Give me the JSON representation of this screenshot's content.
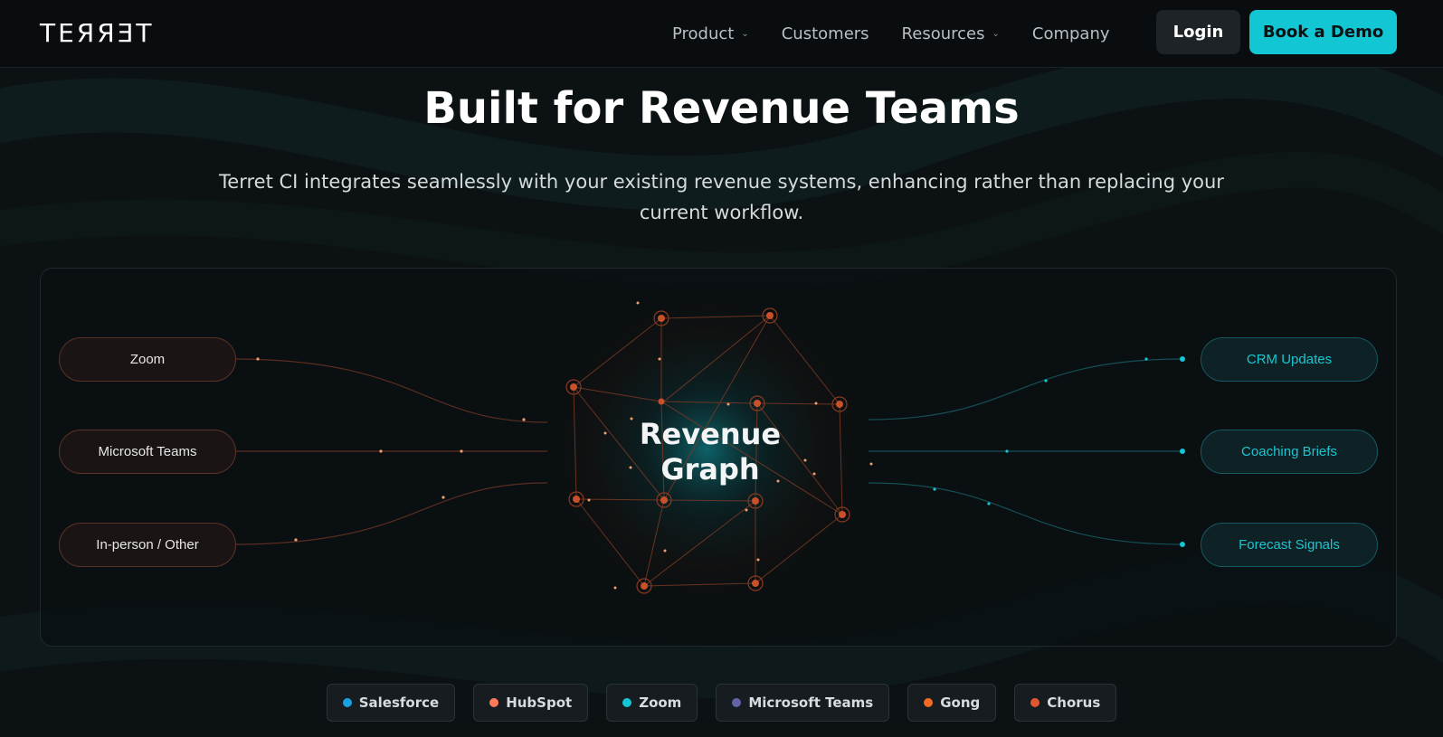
{
  "nav": {
    "logo": "TEЯЯƎT",
    "links": [
      {
        "label": "Product",
        "has_dropdown": true
      },
      {
        "label": "Customers",
        "has_dropdown": false
      },
      {
        "label": "Resources",
        "has_dropdown": true
      },
      {
        "label": "Company",
        "has_dropdown": false
      }
    ],
    "login_label": "Login",
    "demo_label": "Book a Demo"
  },
  "hero": {
    "title": "Built for Revenue Teams",
    "subtitle": "Terret CI integrates seamlessly with your existing revenue systems, enhancing rather than replacing your current workflow."
  },
  "diagram": {
    "inputs": [
      "Zoom",
      "Microsoft Teams",
      "In-person / Other"
    ],
    "center_line1": "Revenue",
    "center_line2": "Graph",
    "outputs": [
      "CRM Updates",
      "Coaching Briefs",
      "Forecast Signals"
    ]
  },
  "integrations": [
    {
      "label": "Salesforce",
      "color": "#1aa2e0"
    },
    {
      "label": "HubSpot",
      "color": "#ff7a59"
    },
    {
      "label": "Zoom",
      "color": "#12c6d3"
    },
    {
      "label": "Microsoft Teams",
      "color": "#6264a7"
    },
    {
      "label": "Gong",
      "color": "#f26b21"
    },
    {
      "label": "Chorus",
      "color": "#e0562f"
    }
  ],
  "colors": {
    "accent": "#12c6d3",
    "input_accent": "#e0562f"
  }
}
